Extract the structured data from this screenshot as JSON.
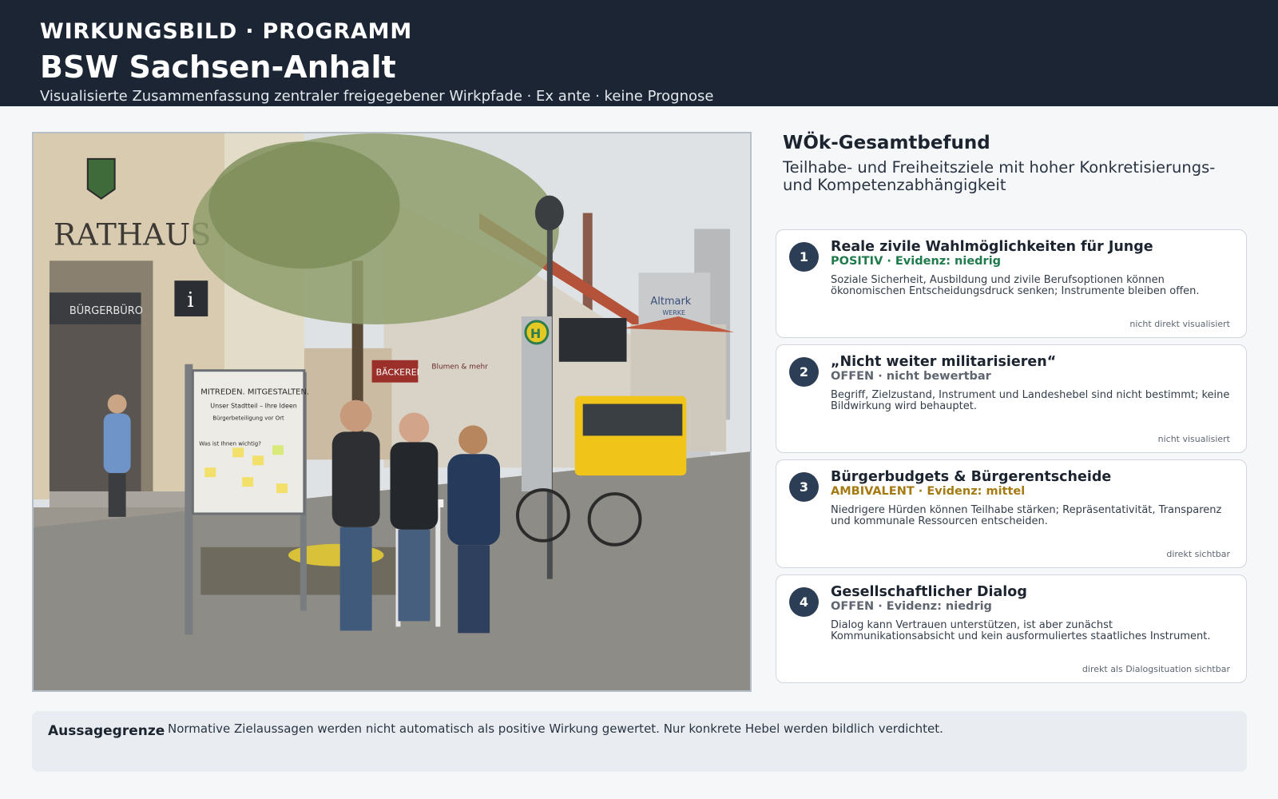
{
  "header": {
    "kicker": "WIRKUNGSBILD · PROGRAMM",
    "title": "BSW Sachsen-Anhalt",
    "subtitle": "Visualisierte Zusammenfassung zentraler freigegebener Wirkpfade · Ex ante · keine Prognose"
  },
  "photo": {
    "signs": {
      "rathaus": "RATHAUS",
      "buergerbuero": "BÜRGERBÜRO",
      "info": "i",
      "board_title": "MITREDEN. MITGESTALTEN.",
      "board_line1": "Unser Stadtteil – Ihre Ideen",
      "board_line2": "Bürgerbeteiligung vor Ort",
      "board_question": "Was ist Ihnen wichtig?",
      "baeckerei": "BÄCKEREI",
      "blumen": "Blumen & mehr",
      "bus_stop": "H",
      "factory_line1": "Altmark",
      "factory_line2": "WERKE"
    },
    "colors": {
      "sky": "#dfe2e4",
      "pavement": "#8d8c86",
      "bus": "#f0c419",
      "sign_bg": "#2b2f33"
    }
  },
  "summary": {
    "title": "WÖk-Gesamtbefund",
    "subtitle": "Teilhabe- und Freiheitsziele mit hoher Konkretisierungs- und Kompetenzabhängigkeit"
  },
  "cards": [
    {
      "number": "1",
      "title": "Reale zivile Wahlmöglichkeiten für Junge",
      "status": "POSITIV · Evidenz: niedrig",
      "status_color": "#1f7a4c",
      "text": "Soziale Sicherheit, Ausbildung und zivile Berufsoptionen können ökonomischen Entscheidungsdruck senken; Instrumente bleiben offen.",
      "footer": "nicht direkt visualisiert"
    },
    {
      "number": "2",
      "title": "„Nicht weiter militarisieren“",
      "status": "OFFEN · nicht bewertbar",
      "status_color": "#5f6670",
      "text": "Begriff, Zielzustand, Instrument und Landeshebel sind nicht bestimmt; keine Bildwirkung wird behauptet.",
      "footer": "nicht visualisiert"
    },
    {
      "number": "3",
      "title": "Bürgerbudgets & Bürgerentscheide",
      "status": "AMBIVALENT · Evidenz: mittel",
      "status_color": "#a67a12",
      "text": "Niedrigere Hürden können Teilhabe stärken; Repräsentativität, Transparenz und kommunale Ressourcen entscheiden.",
      "footer": "direkt sichtbar"
    },
    {
      "number": "4",
      "title": "Gesellschaftlicher Dialog",
      "status": "OFFEN · Evidenz: niedrig",
      "status_color": "#5f6670",
      "text": "Dialog kann Vertrauen unterstützen, ist aber zunächst Kommunikationsabsicht und kein ausformuliertes staatliches Instrument.",
      "footer": "direkt als Dialogsituation sichtbar"
    }
  ],
  "limit": {
    "label": "Aussagegrenze",
    "text": "Normative Zielaussagen werden nicht automatisch als positive Wirkung gewertet. Nur konkrete Hebel werden bildlich verdichtet."
  }
}
